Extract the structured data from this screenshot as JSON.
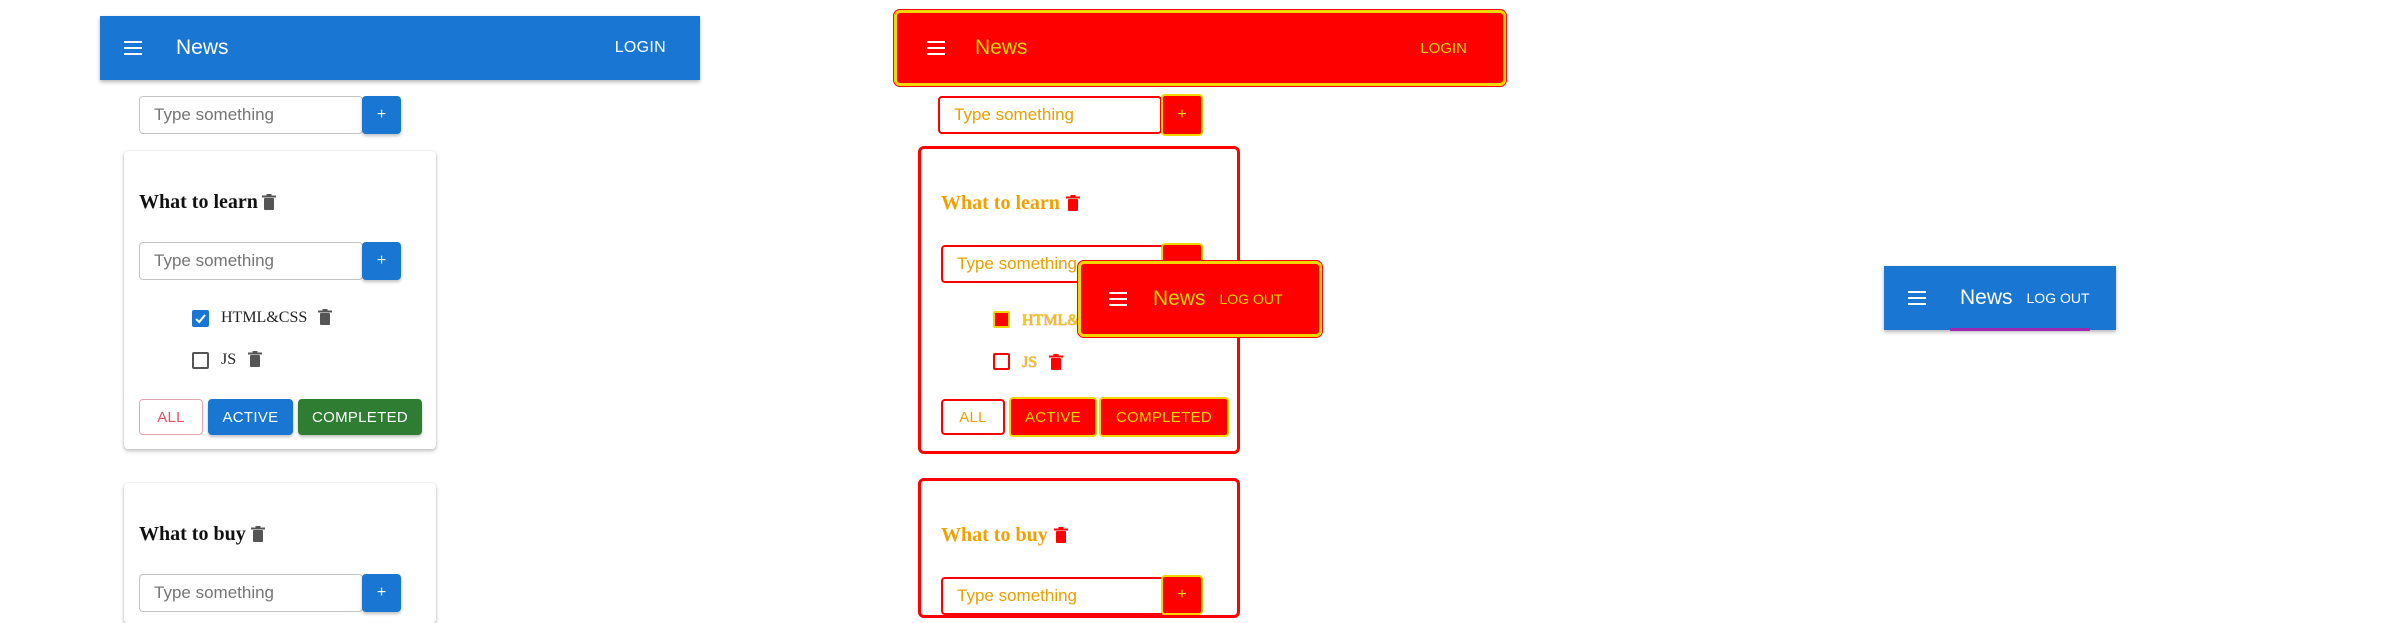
{
  "app": {
    "title": "News",
    "login_label": "LOGIN",
    "logout_label": "LOG OUT"
  },
  "add_form": {
    "placeholder": "Type something",
    "add_label": "+"
  },
  "todolists": [
    {
      "title": "What to learn",
      "tasks": [
        {
          "title": "HTML&CSS",
          "done": true
        },
        {
          "title": "JS",
          "done": false
        }
      ]
    },
    {
      "title": "What to buy"
    }
  ],
  "filters": {
    "all": "ALL",
    "active": "ACTIVE",
    "completed": "COMPLETED"
  },
  "colors": {
    "primary": "#1976d2",
    "success": "#2e7d32",
    "debug_red": "#ff0000",
    "debug_yellow": "#f2d600",
    "accent_purple": "#9c27b0"
  },
  "icons": [
    "menu-icon",
    "trash-icon",
    "check-icon"
  ]
}
